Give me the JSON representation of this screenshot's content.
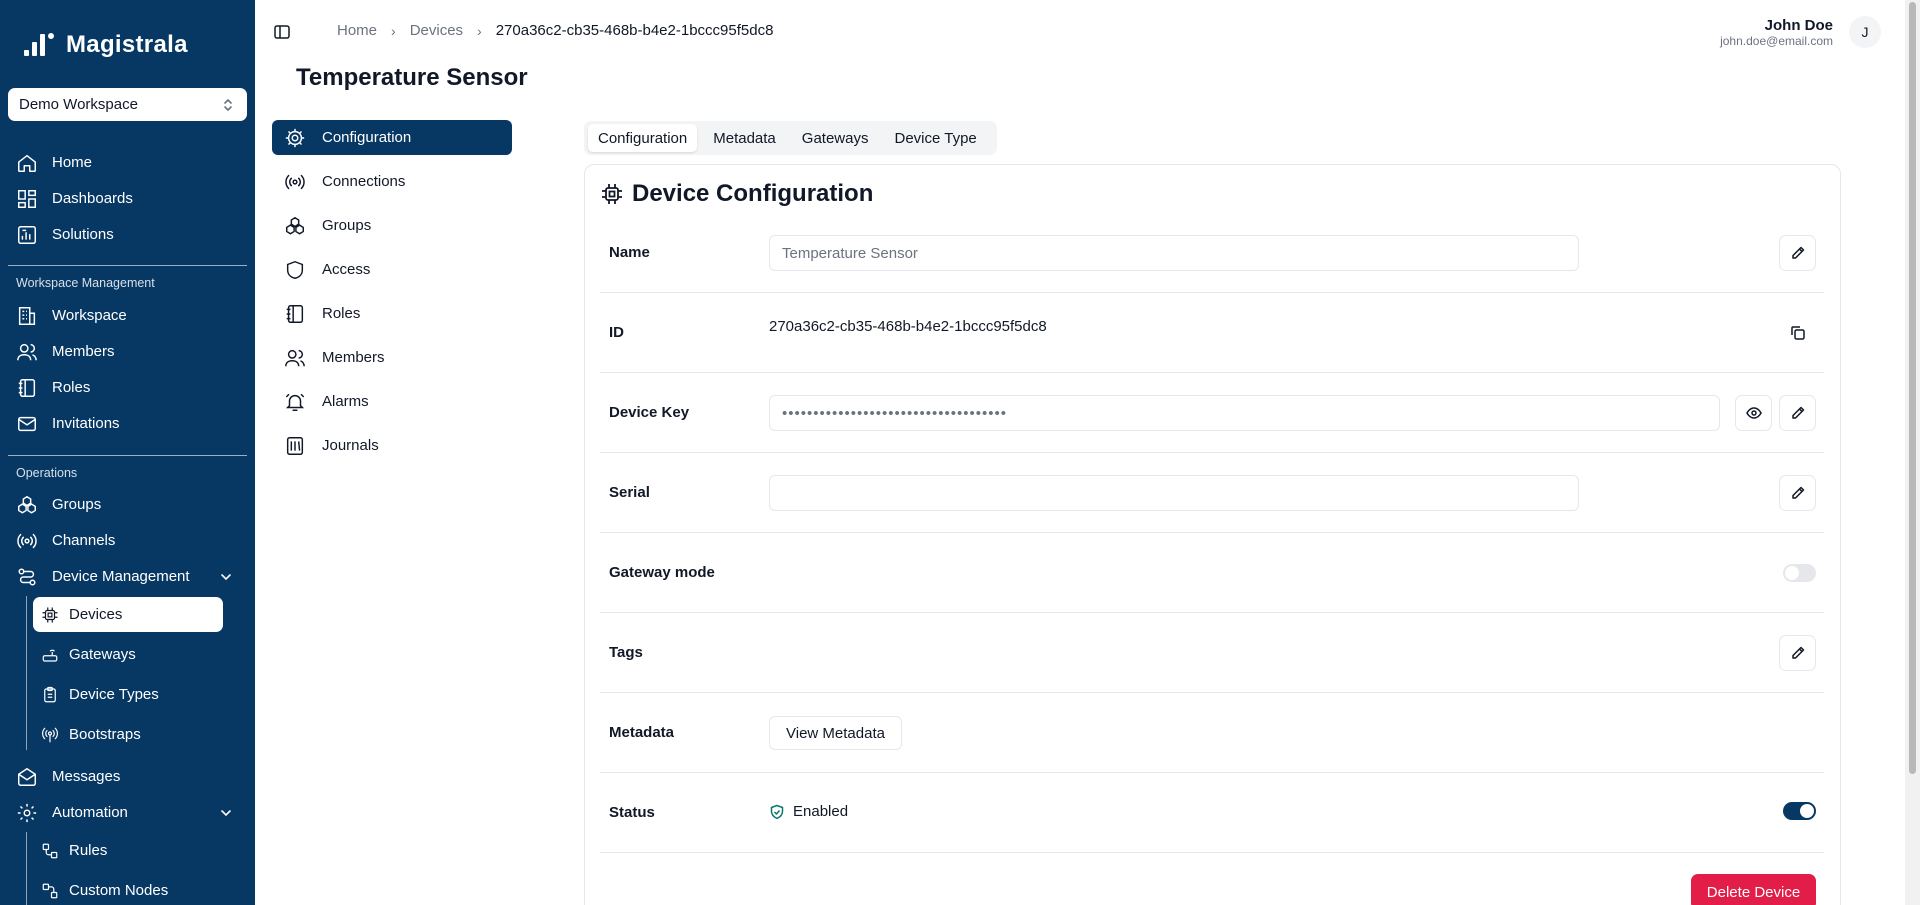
{
  "app": {
    "brand": "Magistrala",
    "workspace_select": "Demo Workspace"
  },
  "sidebar": {
    "main": [
      {
        "label": "Home",
        "icon": "home-icon"
      },
      {
        "label": "Dashboards",
        "icon": "dashboards-icon"
      },
      {
        "label": "Solutions",
        "icon": "solutions-icon"
      }
    ],
    "workspace_section": "Workspace Management",
    "workspace_items": [
      {
        "label": "Workspace",
        "icon": "building-icon"
      },
      {
        "label": "Members",
        "icon": "users-icon"
      },
      {
        "label": "Roles",
        "icon": "notebook-icon"
      },
      {
        "label": "Invitations",
        "icon": "mail-icon"
      }
    ],
    "operations_section": "Operations",
    "operations_items": [
      {
        "label": "Groups",
        "icon": "groups-icon"
      },
      {
        "label": "Channels",
        "icon": "radio-icon"
      },
      {
        "label": "Device Management",
        "icon": "route-icon"
      }
    ],
    "device_sub": [
      {
        "label": "Devices",
        "icon": "chip-icon"
      },
      {
        "label": "Gateways",
        "icon": "router-icon"
      },
      {
        "label": "Device Types",
        "icon": "clipboard-icon"
      },
      {
        "label": "Bootstraps",
        "icon": "antenna-icon"
      }
    ],
    "after_items": [
      {
        "label": "Messages",
        "icon": "mail-open-icon"
      },
      {
        "label": "Automation",
        "icon": "automation-icon"
      }
    ],
    "automation_sub": [
      {
        "label": "Rules",
        "icon": "workflow-icon"
      },
      {
        "label": "Custom Nodes",
        "icon": "nodes-icon"
      }
    ]
  },
  "header": {
    "breadcrumb": [
      "Home",
      "Devices",
      "270a36c2-cb35-468b-b4e2-1bccc95f5dc8"
    ],
    "user_name": "John Doe",
    "user_email": "john.doe@email.com",
    "avatar_initial": "J"
  },
  "page": {
    "title": "Temperature Sensor"
  },
  "secondary_menu": [
    {
      "label": "Configuration",
      "icon": "gear-icon"
    },
    {
      "label": "Connections",
      "icon": "radio-icon"
    },
    {
      "label": "Groups",
      "icon": "groups-icon"
    },
    {
      "label": "Access",
      "icon": "shield-icon"
    },
    {
      "label": "Roles",
      "icon": "notebook-icon"
    },
    {
      "label": "Members",
      "icon": "users-icon"
    },
    {
      "label": "Alarms",
      "icon": "bell-icon"
    },
    {
      "label": "Journals",
      "icon": "journal-icon"
    }
  ],
  "tabs": [
    "Configuration",
    "Metadata",
    "Gateways",
    "Device Type"
  ],
  "config": {
    "title": "Device Configuration",
    "name_label": "Name",
    "name_value": "Temperature Sensor",
    "id_label": "ID",
    "id_value": "270a36c2-cb35-468b-b4e2-1bccc95f5dc8",
    "key_label": "Device Key",
    "key_value": "••••••••••••••••••••••••••••••••••••",
    "serial_label": "Serial",
    "serial_value": "",
    "gateway_label": "Gateway mode",
    "gateway_enabled": false,
    "tags_label": "Tags",
    "metadata_label": "Metadata",
    "metadata_button": "View Metadata",
    "status_label": "Status",
    "status_value": "Enabled",
    "status_enabled": true,
    "delete_button": "Delete Device"
  },
  "colors": {
    "sidebar": "#073763",
    "accent": "#073763",
    "danger": "#e11d48"
  }
}
